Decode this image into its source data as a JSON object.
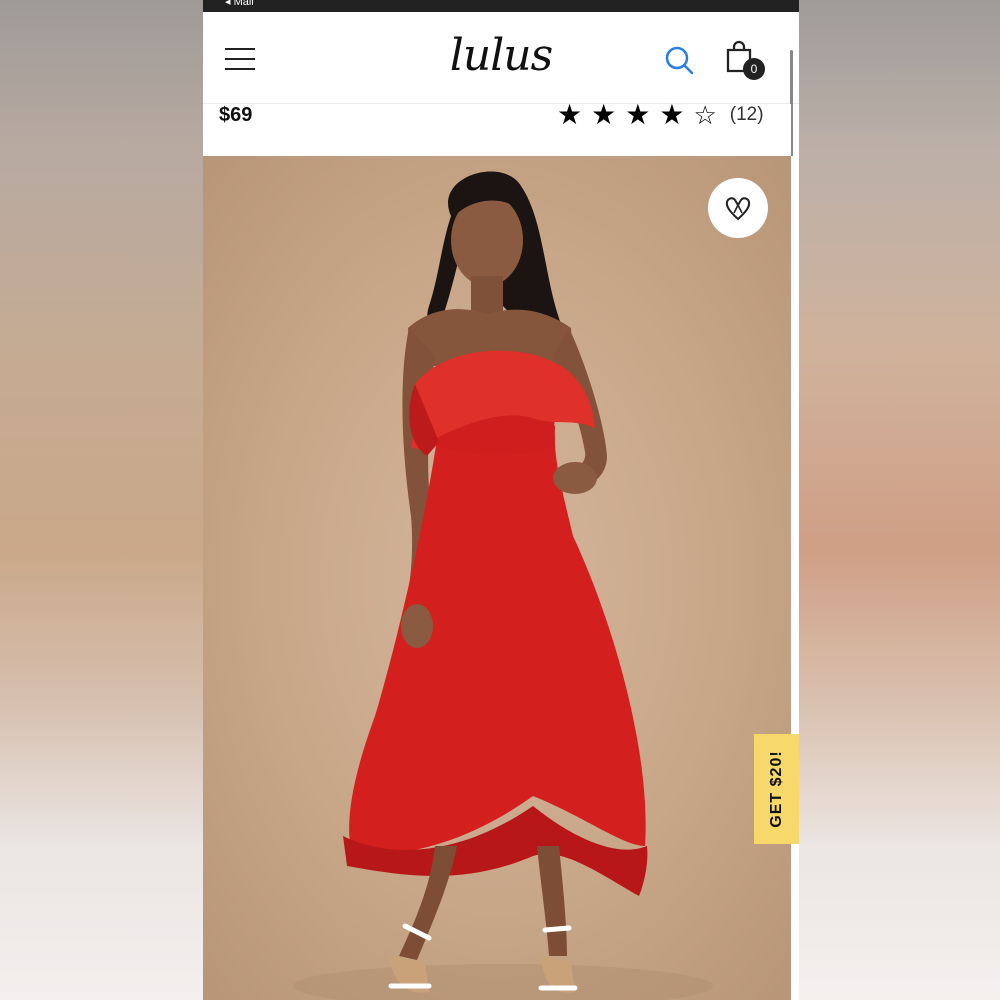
{
  "status_bar": {
    "back_label": "◂ Mail"
  },
  "header": {
    "logo_text": "lulus",
    "cart_count": "0",
    "menu_icon": "hamburger-icon",
    "search_icon": "search-icon",
    "cart_icon": "shopping-bag-icon"
  },
  "product": {
    "price": "$69",
    "rating_stars": 4,
    "rating_max": 5,
    "review_count": "(12)",
    "dress_color": "#d3201f"
  },
  "photo": {
    "wishlist_icon": "heart-icon"
  },
  "promo": {
    "label": "GET $20!"
  },
  "colors": {
    "accent": "#2a7de1",
    "promo_bg": "#f7d96b"
  }
}
